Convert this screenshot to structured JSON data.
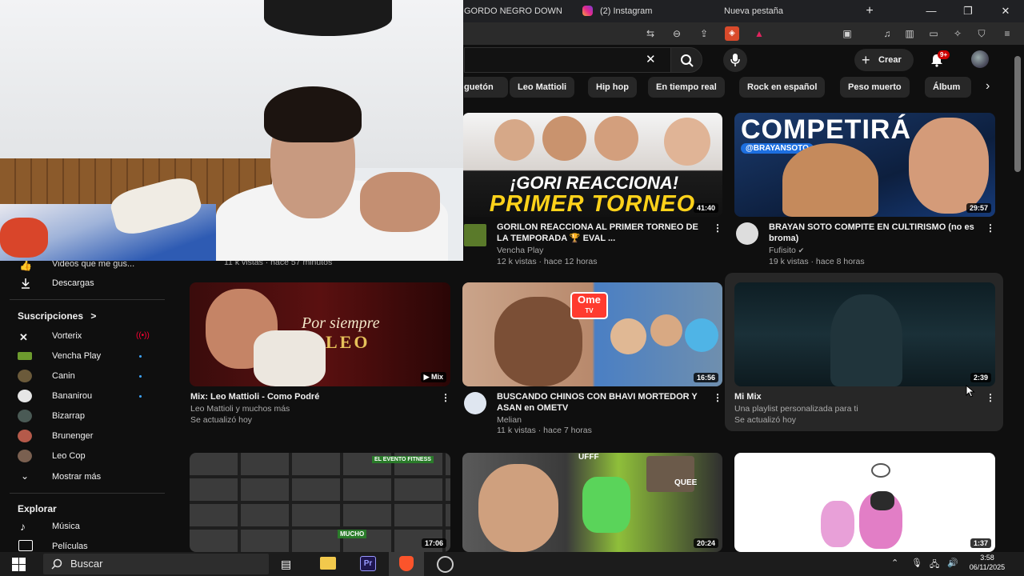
{
  "browser": {
    "tabs": [
      {
        "label": "GORDO NEGRO DOWN"
      },
      {
        "label": "(2) Instagram"
      },
      {
        "label": "Nueva pestaña"
      }
    ],
    "new_tab": "+",
    "minimize": "—",
    "restore": "❐",
    "close": "✕"
  },
  "youtube": {
    "search_clear": "✕",
    "create_label": "Crear",
    "notif_badge": "9+",
    "chips": [
      "guetón",
      "Leo Mattioli",
      "Hip hop",
      "En tiempo real",
      "Rock en español",
      "Peso muerto",
      "Álbum"
    ],
    "sidebar": {
      "liked_videos": "Videos que me gus...",
      "downloads": "Descargas",
      "subs_heading": "Suscripciones",
      "subs_chevron": ">",
      "subs": [
        {
          "label": "Vorterix",
          "icon": "vorterix-logo-icon",
          "live": true
        },
        {
          "label": "Vencha Play",
          "icon": "vencha-avatar",
          "new": true
        },
        {
          "label": "Canin",
          "icon": "canin-avatar",
          "new": true
        },
        {
          "label": "Bananirou",
          "icon": "bananirou-avatar",
          "new": true
        },
        {
          "label": "Bizarrap",
          "icon": "bizarrap-avatar"
        },
        {
          "label": "Brunenger",
          "icon": "brunenger-avatar"
        },
        {
          "label": "Leo Cop",
          "icon": "leocop-avatar"
        }
      ],
      "show_more": "Mostrar más",
      "explore_heading": "Explorar",
      "explore": [
        {
          "label": "Música"
        },
        {
          "label": "Películas"
        }
      ]
    },
    "partial_meta": "11 k vistas · hace 57 minutos",
    "videos": [
      {
        "title": "GORILON REACCIONA AL PRIMER TORNEO DE LA TEMPORADA 🏆 EVAL ...",
        "channel": "Vencha Play",
        "meta": "12 k vistas · hace 12 horas",
        "duration": "41:40",
        "thumb_text_1": "¡GORI REACCIONA!",
        "thumb_text_2": "PRIMER TORNEO"
      },
      {
        "title": "BRAYAN SOTO COMPITE EN CULTIRISMO (no es broma)",
        "channel": "Fufisito",
        "meta": "19 k vistas · hace 8 horas",
        "duration": "29:57",
        "thumb_text_1": "COMPETIRÁ",
        "thumb_text_2": "@BRAYANSOTO"
      },
      {
        "title": "Mix: Leo Mattioli - Como Podré",
        "channel": "Leo Mattioli y muchos más",
        "meta": "Se actualizó hoy",
        "duration": "Mix",
        "thumb_text_1": "Por siempre",
        "thumb_text_2": "LEO"
      },
      {
        "title": "BUSCANDO CHINOS CON BHAVI MORTEDOR Y ASAN en OMETV",
        "channel": "Melian",
        "meta": "11 k vistas · hace 7 horas",
        "duration": "16:56",
        "thumb_text_1": "Ome",
        "thumb_text_2": "TV"
      },
      {
        "title": "Mi Mix",
        "channel": "Una playlist personalizada para ti",
        "meta": "Se actualizó hoy",
        "duration": "2:39"
      },
      {
        "duration": "17:06",
        "thumb_text_1": "EL EVENTO FITNESS",
        "thumb_text_2": "MUCHO"
      },
      {
        "duration": "20:24",
        "thumb_text_1": "UFFF",
        "thumb_text_2": "QUEE"
      },
      {
        "duration": "1:37"
      }
    ]
  },
  "taskbar": {
    "search_label": "Buscar",
    "time": "3:58",
    "date": "06/11/2025"
  },
  "colors": {
    "accent_red": "#ff0033",
    "link_blue": "#3ea6ff",
    "background": "#0f0f0f"
  }
}
